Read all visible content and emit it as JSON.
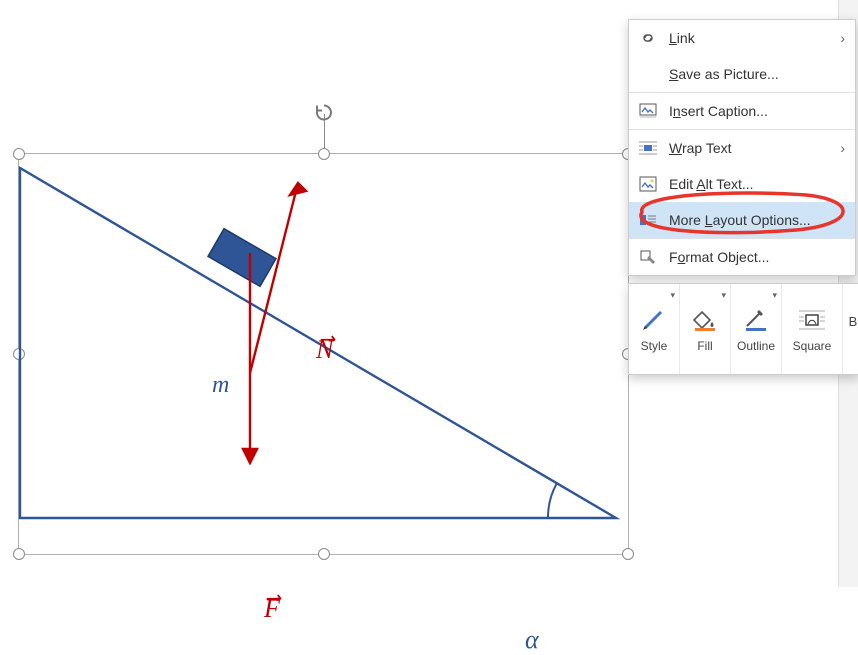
{
  "menu": {
    "link": "Link",
    "save_as_picture": "Save as Picture...",
    "insert_caption": "Insert Caption...",
    "wrap_text": "Wrap Text",
    "edit_alt": "Edit Alt Text...",
    "more_layout": "More Layout Options...",
    "format_object": "Format Object..."
  },
  "quick_panel": {
    "style": "Style",
    "fill": "Fill",
    "outline": "Outline",
    "square": "Square",
    "right_letter": "B"
  },
  "diagram": {
    "mass_label": "m",
    "normal_label": "N",
    "force_label": "F",
    "angle_label": "α"
  }
}
